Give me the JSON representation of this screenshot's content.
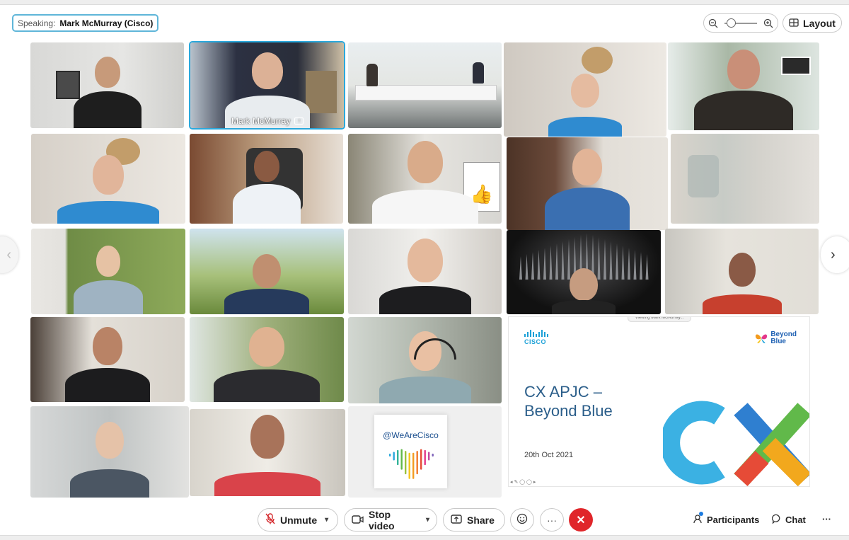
{
  "speaking": {
    "label": "Speaking:",
    "name": "Mark McMurray (Cisco)"
  },
  "toolbar_top": {
    "layout_label": "Layout",
    "zoom_level": 0.2
  },
  "active_tile": {
    "name": "Mark McMurray"
  },
  "slide": {
    "brand": "CISCO",
    "partner_line1": "Beyond",
    "partner_line2": "Blue",
    "title_line1": "CX APJC –",
    "title_line2": "Beyond Blue",
    "date": "20th Oct 2021",
    "viewing": "Viewing Mark McMurray..."
  },
  "sticker": {
    "text": "@WeAreCisco"
  },
  "controls": {
    "unmute": "Unmute",
    "stop_video": "Stop video",
    "share": "Share",
    "participants": "Participants",
    "chat": "Chat"
  },
  "colors": {
    "accent": "#2aa8dc",
    "end_call": "#e0262a",
    "cisco_blue": "#1ba0d7",
    "slide_title": "#2b5e8a"
  }
}
